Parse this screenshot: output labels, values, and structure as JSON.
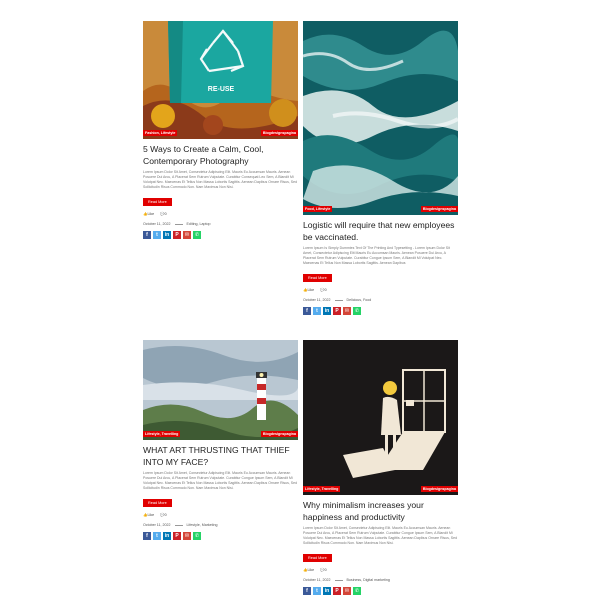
{
  "posts": [
    {
      "category": "Fashion, Lifestyle",
      "author": "Blogdesignspagina",
      "title": "5 Ways to Create a Calm, Cool, Contemporary Photography",
      "excerpt": "Lorem Ipsum Dolor Sit Amet, Consectetur Adipiscing Elit. Mauris Eu Accumsan Mauris. Aenean Posuere Dui Arcu, A Placerat Sem Rutrum Vulputate. Curabitur Consequat Leo Sem, A Blandit Mi Volutpat Nec. Maecenas Et Tellus Non Massa Lobortis Sagittis. Aenean Dapibus Ornare Risus, Sed Sollicitudin Risus Commodo Non. Nam Maximus Non Nisi.",
      "read_more": "Read More",
      "likes": "Like",
      "comments": "0",
      "date": "October 11, 2022",
      "tags": "Editing, Laptop"
    },
    {
      "category": "Food, Lifestyle",
      "author": "Blogdesignspagina",
      "title": "Logistic will require that new employees be vaccinated.",
      "excerpt": "Lorem Ipsum Is Simply Dummies Text Of The Printing And Typesetting - Lorem Ipsum Dolor Sit Amet, Consectetur Adipiscing Elit Mauris Eu Accumsan Mauris. Aenean Posuere Dui Arcu, A Placerat Sem Rutrum Vulputate. Curabitur Congue Ipsum Sem, A Blandit Mi Volutpat Nec. Maecenas Et Tellus Non Massa Lobortis Sagittis. Aenean Dapibus",
      "read_more": "Read More",
      "likes": "Like",
      "comments": "0",
      "date": "October 11, 2022",
      "tags": "Delicious, Food"
    },
    {
      "category": "Lifestyle, Travelling",
      "author": "Blogdesignspagina",
      "title": "WHAT ART THRUSTING THAT THIEF INTO MY FACE?",
      "excerpt": "Lorem Ipsum Dolor Sit Amet, Consectetur Adipiscing Elit. Mauris Eu Accumsan Mauris. Aenean Posuere Dui Arcu, A Placerat Sem Rutrum Vulputate. Curabitur Congue Ipsum Sem, A Blandit Mi Volutpat Nec. Maecenas Et Tellus Non Massa Lobortis Sagittis. Aenean Dapibus Ornare Risus, Sed Sollicitudin Risus Commodo Non. Nam Maximus Non Nisi.",
      "read_more": "Read More",
      "likes": "Like",
      "comments": "0",
      "date": "October 11, 2022",
      "tags": "Lifestyle, Marketing"
    },
    {
      "category": "Lifestyle, Travelling",
      "author": "Blogdesignspagina",
      "title": "Why minimalism increases your happiness and productivity",
      "excerpt": "Lorem Ipsum Dolor Sit Amet, Consectetur Adipiscing Elit. Mauris Eu Accumsan Mauris. Aenean Posuere Dui Arcu, A Placerat Sem Rutrum Vulputate. Curabitur Congue Ipsum Sem, A Blandit Mi Volutpat Nec. Maecenas Et Tellus Non Massa Lobortis Sagittis. Aenean Dapibus Ornare Risus, Sed Sollicitudin Risus Commodo Non. Nam Maximus Non Nisi.",
      "read_more": "Read More",
      "likes": "Like",
      "comments": "0",
      "date": "October 11, 2022",
      "tags": "Business, Digital marketing"
    }
  ],
  "share_buttons": [
    {
      "icon": "facebook-icon",
      "glyph": "f",
      "color": "#3b5998"
    },
    {
      "icon": "twitter-icon",
      "glyph": "t",
      "color": "#55acee"
    },
    {
      "icon": "linkedin-icon",
      "glyph": "in",
      "color": "#0077b5"
    },
    {
      "icon": "pinterest-icon",
      "glyph": "P",
      "color": "#cb2027"
    },
    {
      "icon": "email-icon",
      "glyph": "✉",
      "color": "#d44638"
    },
    {
      "icon": "whatsapp-icon",
      "glyph": "✆",
      "color": "#25d366"
    }
  ],
  "colors": {
    "accent": "#e00000"
  }
}
